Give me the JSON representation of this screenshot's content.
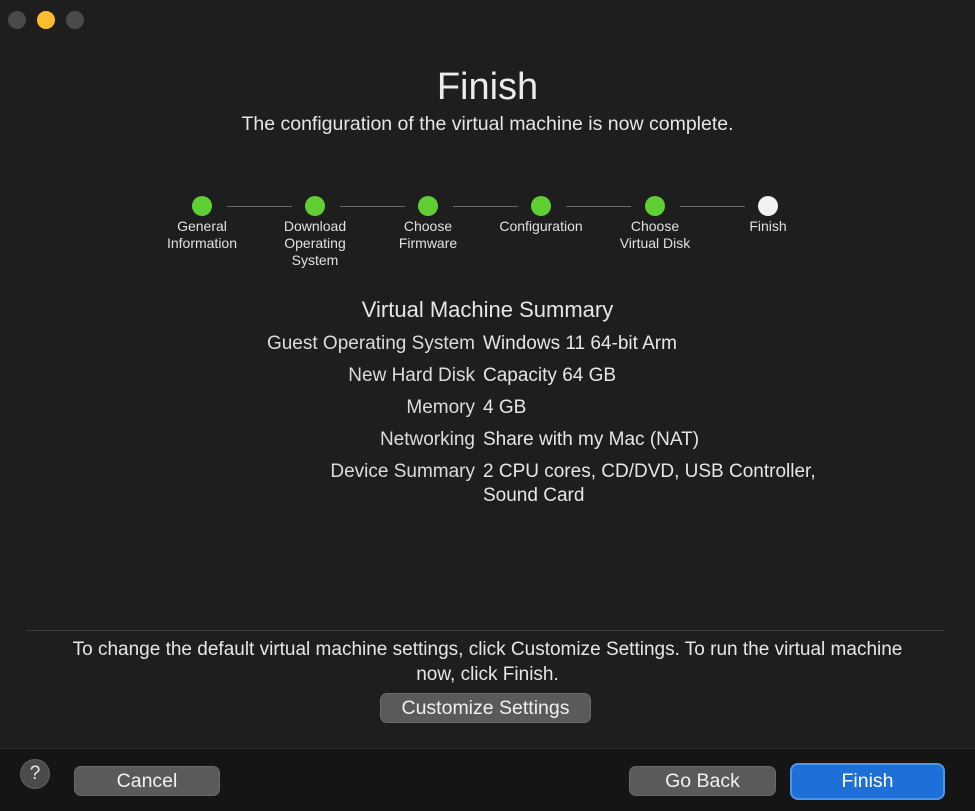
{
  "window": {
    "title": "Finish"
  },
  "header": {
    "title": "Finish",
    "subtitle": "The configuration of the virtual machine is now complete."
  },
  "steps": [
    {
      "label": "General\nInformation",
      "state": "completed"
    },
    {
      "label": "Download\nOperating\nSystem",
      "state": "completed"
    },
    {
      "label": "Choose\nFirmware",
      "state": "completed"
    },
    {
      "label": "Configuration",
      "state": "completed"
    },
    {
      "label": "Choose\nVirtual Disk",
      "state": "completed"
    },
    {
      "label": "Finish",
      "state": "current"
    }
  ],
  "summary": {
    "title": "Virtual Machine Summary",
    "rows": [
      {
        "label": "Guest Operating System",
        "value": "Windows 11 64-bit Arm"
      },
      {
        "label": "New Hard Disk",
        "value": "Capacity 64 GB"
      },
      {
        "label": "Memory",
        "value": "4 GB"
      },
      {
        "label": "Networking",
        "value": "Share with my Mac (NAT)"
      },
      {
        "label": "Device Summary",
        "value": "2 CPU cores, CD/DVD, USB Controller, Sound Card"
      }
    ]
  },
  "hint": "To change the default virtual machine settings, click Customize Settings. To run the virtual machine now, click Finish.",
  "buttons": {
    "customize": "Customize Settings",
    "help": "?",
    "cancel": "Cancel",
    "go_back": "Go Back",
    "finish": "Finish"
  },
  "colors": {
    "background": "#1e1e1e",
    "step_completed": "#5fcf34",
    "step_current": "#f2f2f2",
    "primary_button": "#1f6fd9"
  }
}
